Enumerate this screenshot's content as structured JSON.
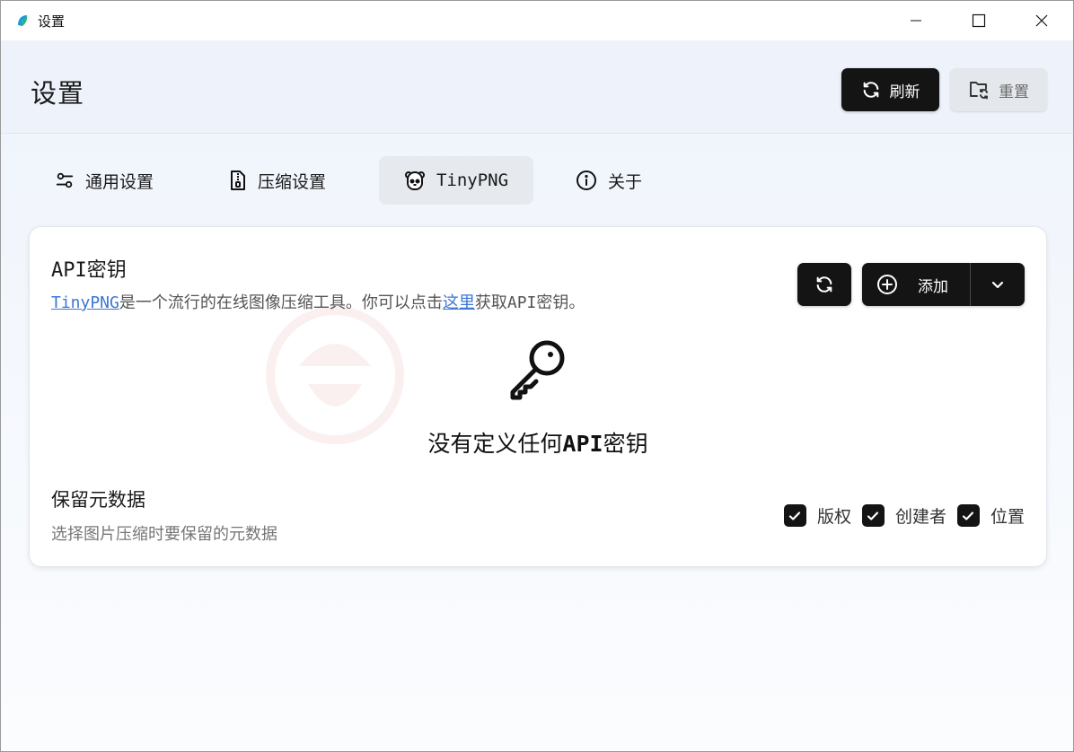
{
  "window": {
    "title": "设置"
  },
  "header": {
    "title": "设置",
    "refresh_label": "刷新",
    "reset_label": "重置"
  },
  "tabs": [
    {
      "label": "通用设置",
      "icon": "sliders-icon"
    },
    {
      "label": "压缩设置",
      "icon": "file-zip-icon"
    },
    {
      "label": "TinyPNG",
      "icon": "panda-icon",
      "active": true
    },
    {
      "label": "关于",
      "icon": "info-icon"
    }
  ],
  "api_keys": {
    "title_prefix": "API",
    "title_suffix": "密钥",
    "desc_link": "TinyPNG",
    "desc_mid": "是一个流行的在线图像压缩工具。你可以点击",
    "desc_here": "这里",
    "desc_end_prefix": "获取",
    "desc_end_api": "API",
    "desc_end_suffix": "密钥。",
    "add_label": "添加",
    "empty_prefix": "没有定义任何",
    "empty_api": "API",
    "empty_suffix": "密钥"
  },
  "metadata": {
    "title": "保留元数据",
    "desc": "选择图片压缩时要保留的元数据",
    "options": [
      {
        "label": "版权",
        "checked": true
      },
      {
        "label": "创建者",
        "checked": true
      },
      {
        "label": "位置",
        "checked": true
      }
    ]
  },
  "colors": {
    "primary_button": "#141414",
    "link": "#3d76d6",
    "header_bg": "#eef3fb"
  }
}
